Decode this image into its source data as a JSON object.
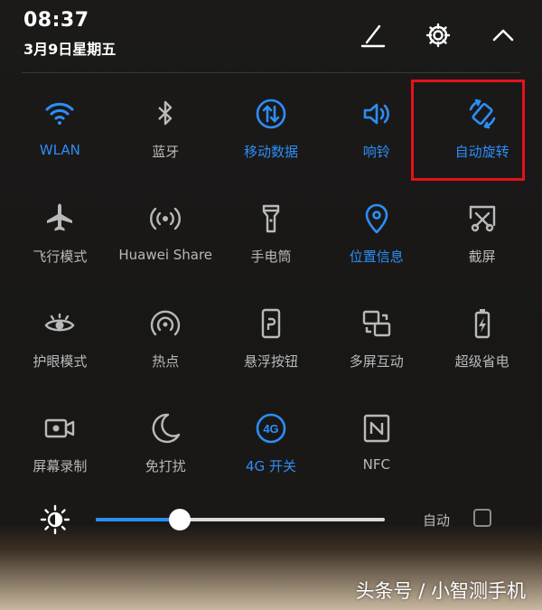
{
  "status": {
    "time": "08:37",
    "date": "3月9日星期五"
  },
  "header_icons": [
    "edit-icon",
    "gear-icon",
    "chevron-up-icon"
  ],
  "tiles": [
    {
      "label": "WLAN",
      "icon": "wifi-icon",
      "active": true
    },
    {
      "label": "蓝牙",
      "icon": "bluetooth-icon",
      "active": false
    },
    {
      "label": "移动数据",
      "icon": "mobile-data-icon",
      "active": true
    },
    {
      "label": "响铃",
      "icon": "sound-icon",
      "active": true
    },
    {
      "label": "自动旋转",
      "icon": "auto-rotate-icon",
      "active": true
    },
    {
      "label": "飞行模式",
      "icon": "airplane-icon",
      "active": false
    },
    {
      "label": "Huawei Share",
      "icon": "huawei-share-icon",
      "active": false
    },
    {
      "label": "手电筒",
      "icon": "flashlight-icon",
      "active": false
    },
    {
      "label": "位置信息",
      "icon": "location-icon",
      "active": true
    },
    {
      "label": "截屏",
      "icon": "screenshot-icon",
      "active": false
    },
    {
      "label": "护眼模式",
      "icon": "eye-comfort-icon",
      "active": false
    },
    {
      "label": "热点",
      "icon": "hotspot-icon",
      "active": false
    },
    {
      "label": "悬浮按钮",
      "icon": "floating-button-icon",
      "active": false
    },
    {
      "label": "多屏互动",
      "icon": "multi-screen-icon",
      "active": false
    },
    {
      "label": "超级省电",
      "icon": "battery-saver-icon",
      "active": false
    },
    {
      "label": "屏幕录制",
      "icon": "screen-record-icon",
      "active": false
    },
    {
      "label": "免打扰",
      "icon": "do-not-disturb-icon",
      "active": false
    },
    {
      "label": "4G 开关",
      "icon": "4g-icon",
      "active": true
    },
    {
      "label": "NFC",
      "icon": "nfc-icon",
      "active": false
    }
  ],
  "brightness": {
    "level": 0.29,
    "auto_label": "自动",
    "auto_checked": false
  },
  "colors": {
    "accent": "#2c8ef8",
    "inactive": "#b9b9b9",
    "highlight": "#e5121c"
  },
  "watermark": "头条号 / 小智测手机"
}
